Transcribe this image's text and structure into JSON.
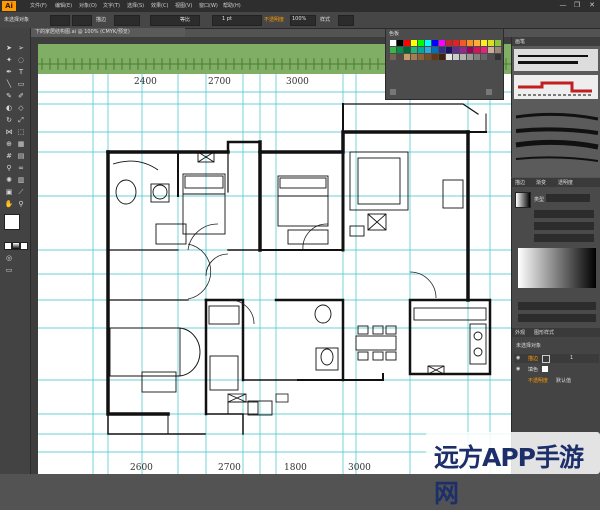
{
  "app": {
    "logo": "Ai"
  },
  "menu": {
    "items": [
      "文件(F)",
      "编辑(E)",
      "对象(O)",
      "文字(T)",
      "选择(S)",
      "效果(C)",
      "视图(V)",
      "窗口(W)",
      "帮助(H)"
    ],
    "window_buttons": [
      "—",
      "❐",
      "✕"
    ]
  },
  "control_bar": {
    "selection_label": "未选择对象",
    "stroke_label": "描边",
    "stroke_value": "1 pt",
    "style_label": "等比",
    "opacity_label": "不透明度",
    "opacity_value": "100%",
    "style_field": "样式"
  },
  "document": {
    "tab_title": "下的家居结构图.ai @ 100% (CMYK/预览)"
  },
  "floorplan": {
    "top_dimensions": [
      "2400",
      "2700",
      "3000"
    ],
    "bottom_dimensions": [
      "2600",
      "2700",
      "1800",
      "3000"
    ]
  },
  "color_panel": {
    "title": "色板"
  },
  "right_panels": {
    "brush_title": "画笔",
    "gradient_tabs": [
      "描边",
      "渐变",
      "透明度"
    ],
    "gradient_type_label": "类型",
    "layers_tabs": [
      "外观",
      "图形样式"
    ],
    "appearance_title": "未选择对象",
    "appearance_rows": [
      "描边",
      "填色",
      "不透明度"
    ],
    "opacity_default": "默认值",
    "stroke_value": "1"
  },
  "watermark": {
    "text": "远方APP手游网"
  },
  "colors": {
    "accent": "#ff9a00",
    "green_band": "#7fae64",
    "guides": "#39c3c9"
  }
}
